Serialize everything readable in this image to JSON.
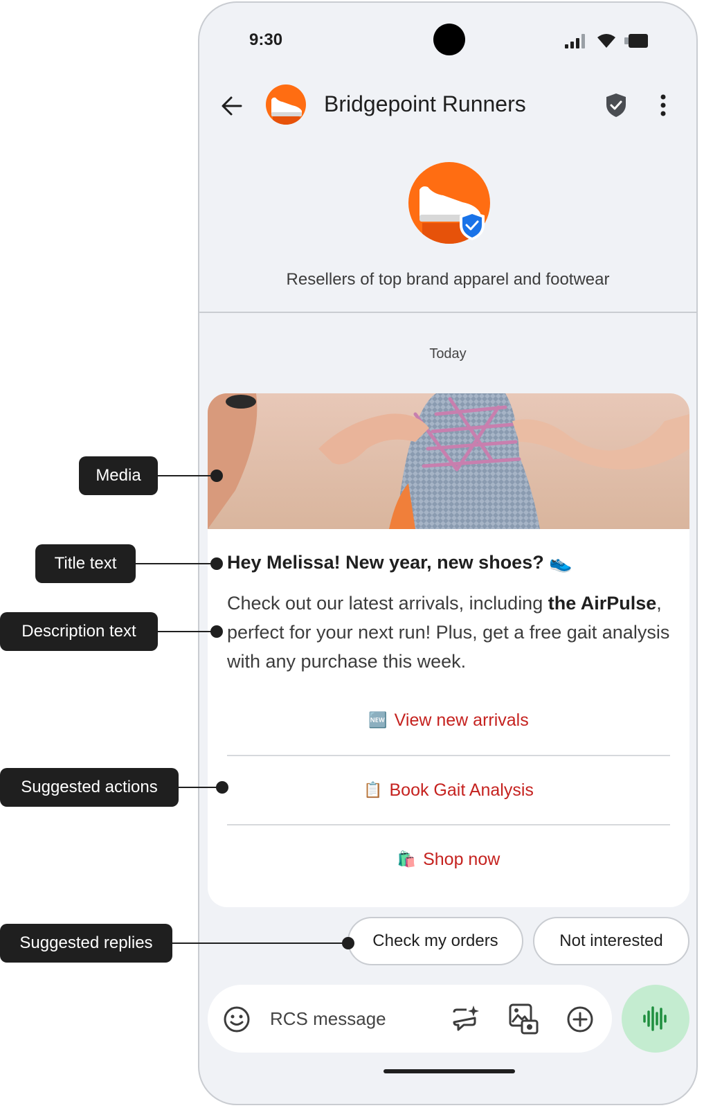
{
  "status_bar": {
    "time": "9:30"
  },
  "app_bar": {
    "title": "Bridgepoint Runners"
  },
  "profile": {
    "description": "Resellers of top brand apparel and footwear"
  },
  "conversation": {
    "date_label": "Today"
  },
  "card": {
    "title": "Hey Melissa! New year, new shoes? 👟",
    "description_prefix": "Check out our latest arrivals, including ",
    "description_bold": "the AirPulse",
    "description_suffix": ", perfect for your next run! Plus, get a free gait analysis with any purchase this week.",
    "actions": [
      {
        "emoji": "🆕",
        "label": "View new arrivals"
      },
      {
        "emoji": "📋",
        "label": "Book Gait Analysis"
      },
      {
        "emoji": "🛍️",
        "label": "Shop now"
      }
    ]
  },
  "suggested_replies": [
    "Check my orders",
    "Not interested"
  ],
  "composer": {
    "placeholder": "RCS message"
  },
  "annotations": {
    "media": "Media",
    "title_text": "Title text",
    "description_text": "Description text",
    "suggested_actions": "Suggested actions",
    "suggested_replies": "Suggested replies"
  },
  "colors": {
    "brand_orange": "#ff6d12",
    "action_red": "#c5221f",
    "voice_green": "#c4ecd0",
    "verified_blue": "#1a73e8"
  },
  "icons": [
    "back-arrow-icon",
    "shoe-avatar-icon",
    "shield-check-icon",
    "more-vert-icon",
    "verified-badge-icon",
    "emoji-icon",
    "magic-compose-icon",
    "gallery-icon",
    "add-circle-icon",
    "voice-wave-icon",
    "signal-icon",
    "wifi-icon",
    "battery-icon"
  ]
}
